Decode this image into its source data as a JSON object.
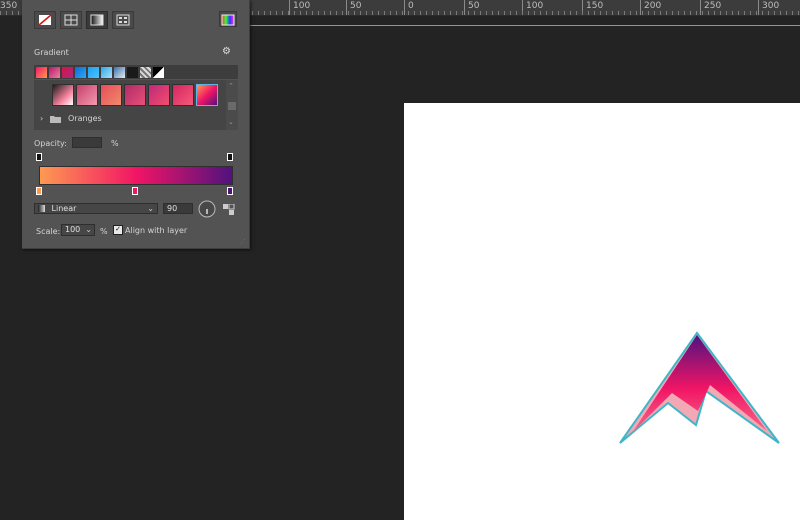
{
  "ruler": {
    "labels": [
      "350",
      "100",
      "50",
      "0",
      "50",
      "100",
      "150",
      "200",
      "250",
      "300"
    ]
  },
  "panel": {
    "title": "Gradient",
    "folder_label": "Oranges",
    "opacity_label": "Opacity:",
    "opacity_value": "",
    "opacity_unit": "%",
    "gradient_type": "Linear",
    "angle_value": "90",
    "scale_label": "Scale:",
    "scale_value": "100",
    "scale_unit": "%",
    "align_label": "Align with layer",
    "align_checked": true,
    "icons": [
      "settings-gear-icon",
      "expand-chevron-icon",
      "folder-icon",
      "angle-dial-icon",
      "reverse-gradient-icon"
    ],
    "preset_colors": [
      [
        "#fe9a52",
        "#f11565",
        "#51127e"
      ]
    ]
  },
  "colors": {
    "gradient_start": "#fe9a52",
    "gradient_mid": "#f11565",
    "gradient_end": "#51127e",
    "guide_line": "#3fb6c8"
  }
}
